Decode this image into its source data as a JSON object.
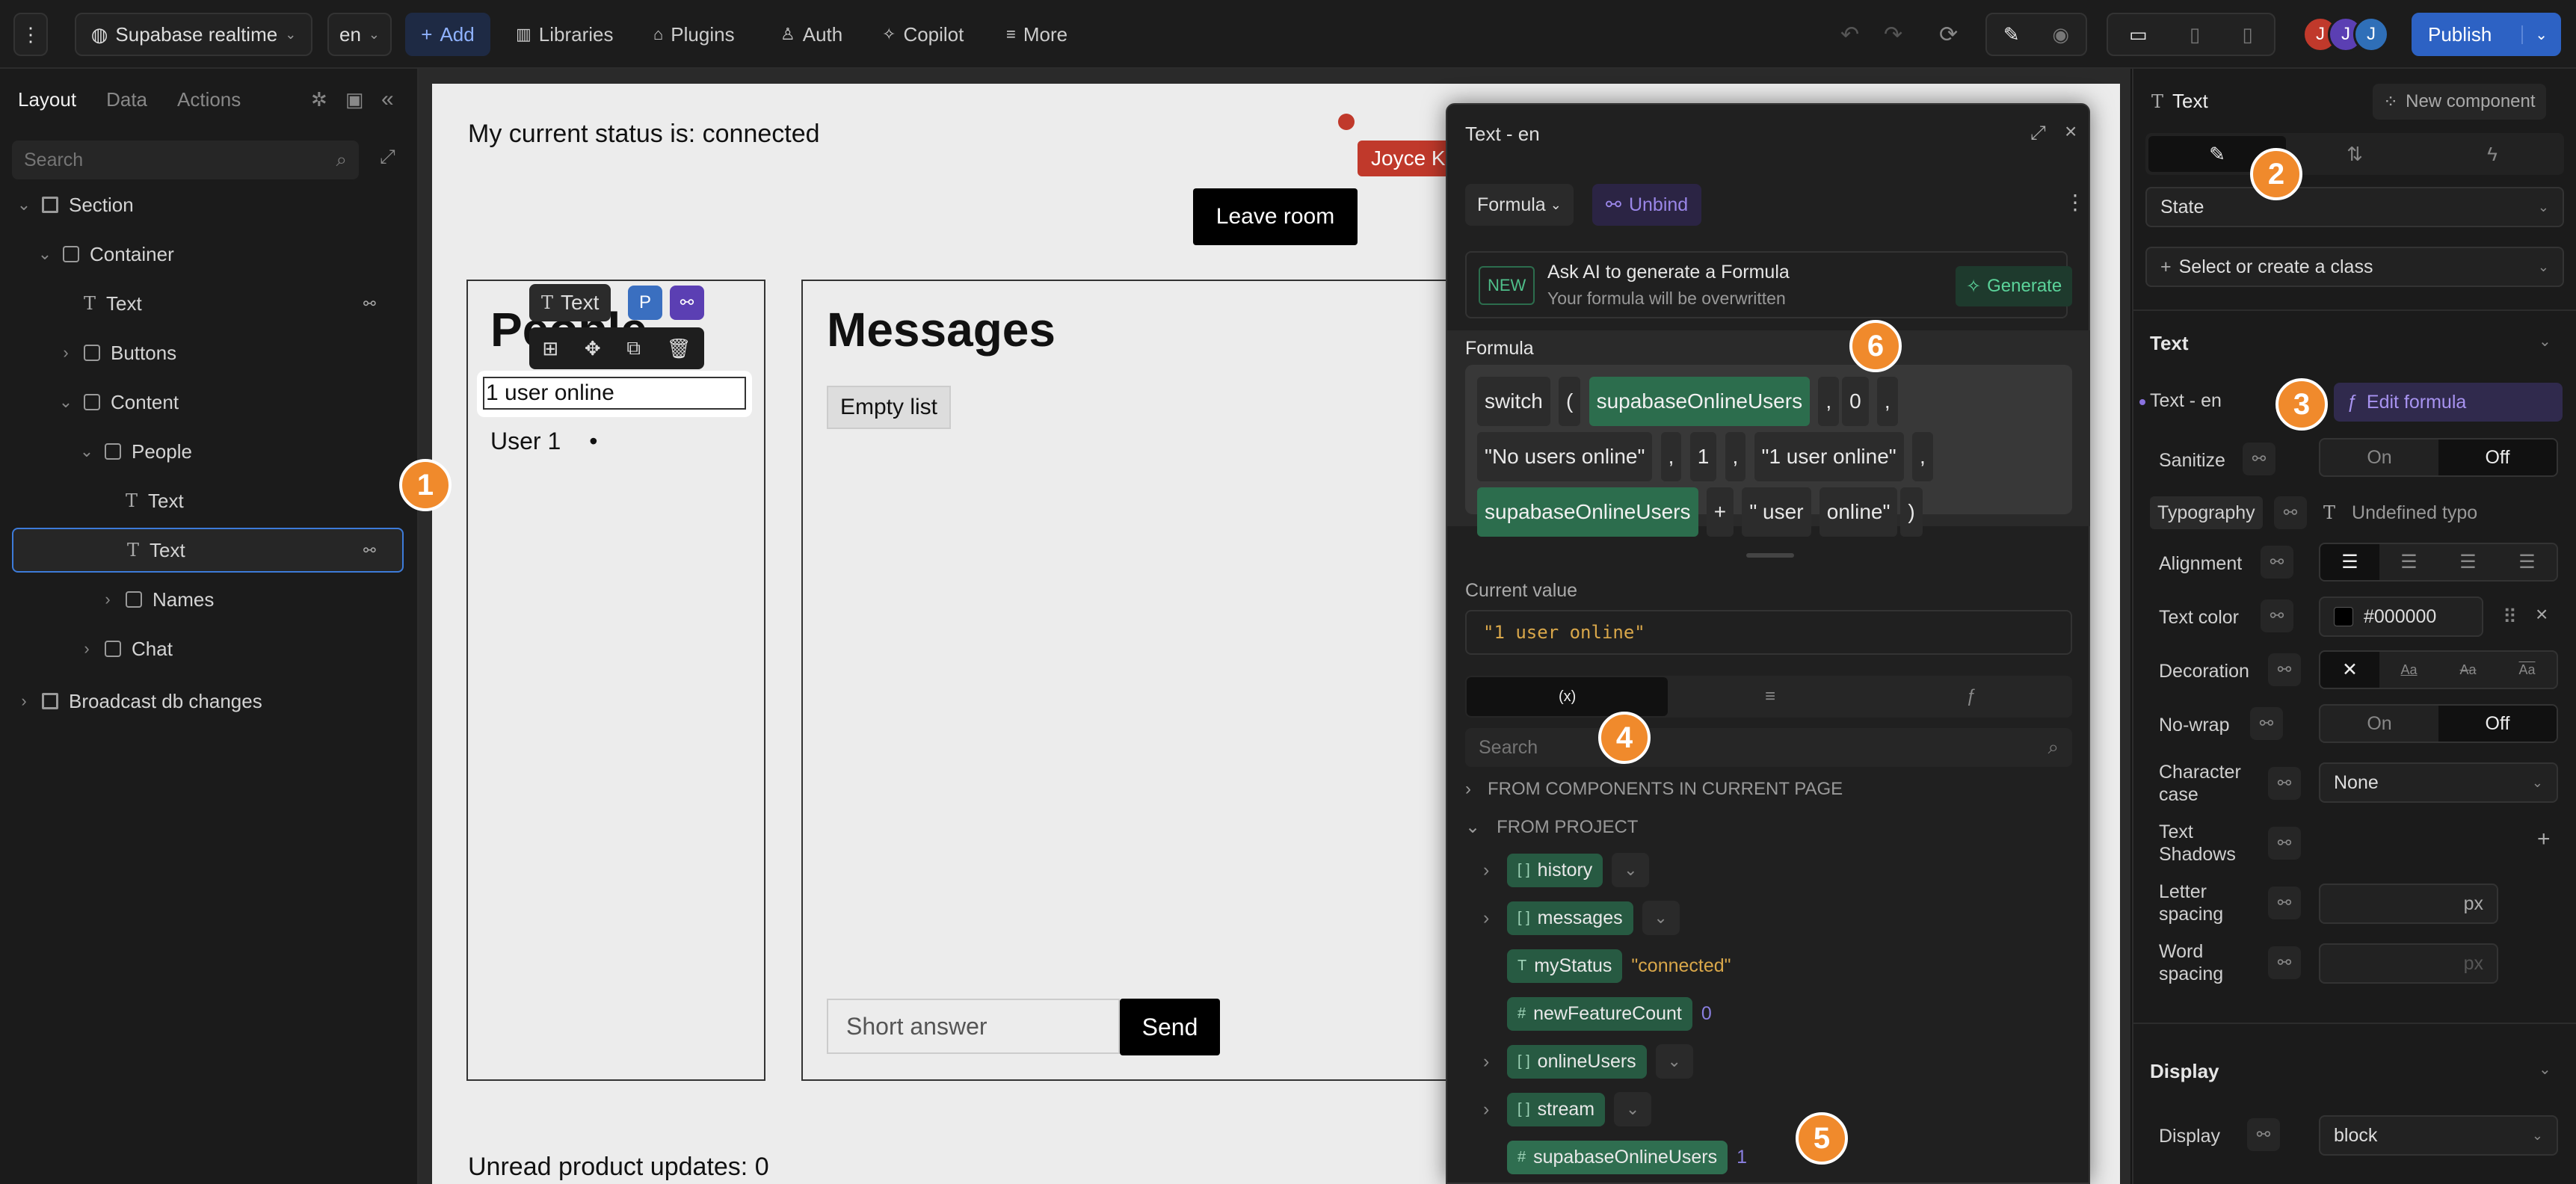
{
  "topbar": {
    "project": "Supabase realtime",
    "lang": "en",
    "add": "Add",
    "libraries": "Libraries",
    "plugins": "Plugins",
    "auth": "Auth",
    "copilot": "Copilot",
    "more": "More",
    "publish": "Publish",
    "avatars": [
      "J",
      "J",
      "J"
    ],
    "avatar_colors": [
      "#c0392b",
      "#5b3fb3",
      "#2f6fb8"
    ]
  },
  "left": {
    "tabs": [
      "Layout",
      "Data",
      "Actions"
    ],
    "search_placeholder": "Search",
    "tree": [
      {
        "label": "Section",
        "indent": 0,
        "icon": "section-icon",
        "chev": "v"
      },
      {
        "label": "Container",
        "indent": 1,
        "icon": "box-icon",
        "chev": "v"
      },
      {
        "label": "Text",
        "indent": 2,
        "icon": "text-icon",
        "chev": ""
      },
      {
        "label": "Buttons",
        "indent": 2,
        "icon": "box-icon",
        "chev": ">"
      },
      {
        "label": "Content",
        "indent": 2,
        "icon": "box-icon",
        "chev": "v"
      },
      {
        "label": "People",
        "indent": 3,
        "icon": "box-icon",
        "chev": "v"
      },
      {
        "label": "Text",
        "indent": 4,
        "icon": "text-icon",
        "chev": ""
      },
      {
        "label": "Text",
        "indent": 4,
        "icon": "text-icon",
        "chev": ""
      },
      {
        "label": "Names",
        "indent": 4,
        "icon": "box-icon",
        "chev": ">"
      },
      {
        "label": "Chat",
        "indent": 3,
        "icon": "box-icon",
        "chev": ">"
      },
      {
        "label": "Broadcast db changes",
        "indent": 0,
        "icon": "section-icon",
        "chev": ">"
      }
    ]
  },
  "page": {
    "status": "My current status is: connected",
    "leave": "Leave room",
    "joyce": "Joyce K",
    "people_title": "People",
    "selected_text": "1 user online",
    "user1": "User 1",
    "messages_title": "Messages",
    "empty_list": "Empty list",
    "short_answer": "Short answer",
    "send": "Send",
    "unread": "Unread product updates: 0",
    "floating_label": "Text",
    "floating_p": "P"
  },
  "dialog": {
    "title": "Text - en",
    "formula_dropdown": "Formula",
    "unbind": "Unbind",
    "new_badge": "NEW",
    "ai_title": "Ask AI to generate a Formula",
    "ai_sub": "Your formula will be overwritten",
    "generate": "Generate",
    "formula_label": "Formula",
    "formula_tokens": {
      "fn": "switch",
      "open": "(",
      "var1": "supabaseOnlineUsers",
      "c1": ",",
      "zero": "0",
      "c2": ",",
      "s1": "\"No users online\"",
      "c3": ",",
      "one": "1",
      "c4": ",",
      "s2": "\"1 user online\"",
      "c5": ",",
      "var2": "supabaseOnlineUsers",
      "plus": "+",
      "s3": "\" user",
      "s3b": "online\"",
      "close": ")"
    },
    "current_value_label": "Current value",
    "current_value": "\"1 user online\"",
    "tabs": [
      "(x)",
      "≡",
      "ƒ"
    ],
    "search_placeholder": "Search",
    "from_components": "FROM COMPONENTS IN CURRENT PAGE",
    "from_project": "FROM PROJECT",
    "vars": [
      {
        "name": "history",
        "type": "[ ]",
        "value": "",
        "expand": true,
        "select": true
      },
      {
        "name": "messages",
        "type": "[ ]",
        "value": "",
        "expand": true,
        "select": true
      },
      {
        "name": "myStatus",
        "type": "T",
        "value": "\"connected\"",
        "expand": false,
        "select": false
      },
      {
        "name": "newFeatureCount",
        "type": "#",
        "value": "0",
        "expand": false,
        "select": false
      },
      {
        "name": "onlineUsers",
        "type": "[ ]",
        "value": "",
        "expand": true,
        "select": true
      },
      {
        "name": "stream",
        "type": "[ ]",
        "value": "",
        "expand": true,
        "select": true
      },
      {
        "name": "supabaseOnlineUsers",
        "type": "#",
        "value": "1",
        "expand": false,
        "select": false
      }
    ]
  },
  "right": {
    "title": "Text",
    "new_component": "New component",
    "state": "State",
    "class": "Select or create a class",
    "text_section": "Text",
    "text_en": "Text - en",
    "edit_formula": "Edit formula",
    "sanitize": "Sanitize",
    "on": "On",
    "off": "Off",
    "typography": "Typography",
    "typo_value": "Undefined typo",
    "alignment": "Alignment",
    "text_color": "Text color",
    "color_value": "#000000",
    "decoration": "Decoration",
    "nowrap": "No-wrap",
    "char_case": "Character case",
    "char_case_value": "None",
    "text_shadows": "Text Shadows",
    "letter_spacing": "Letter spacing",
    "word_spacing": "Word spacing",
    "px": "px",
    "display_section": "Display",
    "display": "Display",
    "display_value": "block"
  },
  "badges": [
    "1",
    "2",
    "3",
    "4",
    "5",
    "6"
  ]
}
